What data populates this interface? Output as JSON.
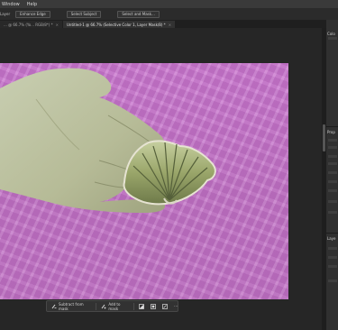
{
  "menubar": {
    "items": [
      "Window",
      "Help"
    ]
  },
  "options_bar": {
    "prefix": "Layer",
    "enhance_edge": "Enhance Edge",
    "select_subject": "Select Subject",
    "select_and_mask": "Select and Mask..."
  },
  "tabs": [
    {
      "label": "... @ 66.7% (Yo... RGB/8*) *",
      "active": false
    },
    {
      "label": "Untitled-1 @ 66.7% (Selective Color 1, Layer Mask/8) *",
      "active": true
    }
  ],
  "taskbar": {
    "subtract": "Subtract from mask",
    "add": "Add to mask",
    "more": "···"
  },
  "right_panel": {
    "color_header": "Colo",
    "props_header": "Prop",
    "layers_header": "Laye"
  },
  "colors": {
    "canvas": "#c478c8",
    "panel": "#303030",
    "workspace": "#262626"
  }
}
